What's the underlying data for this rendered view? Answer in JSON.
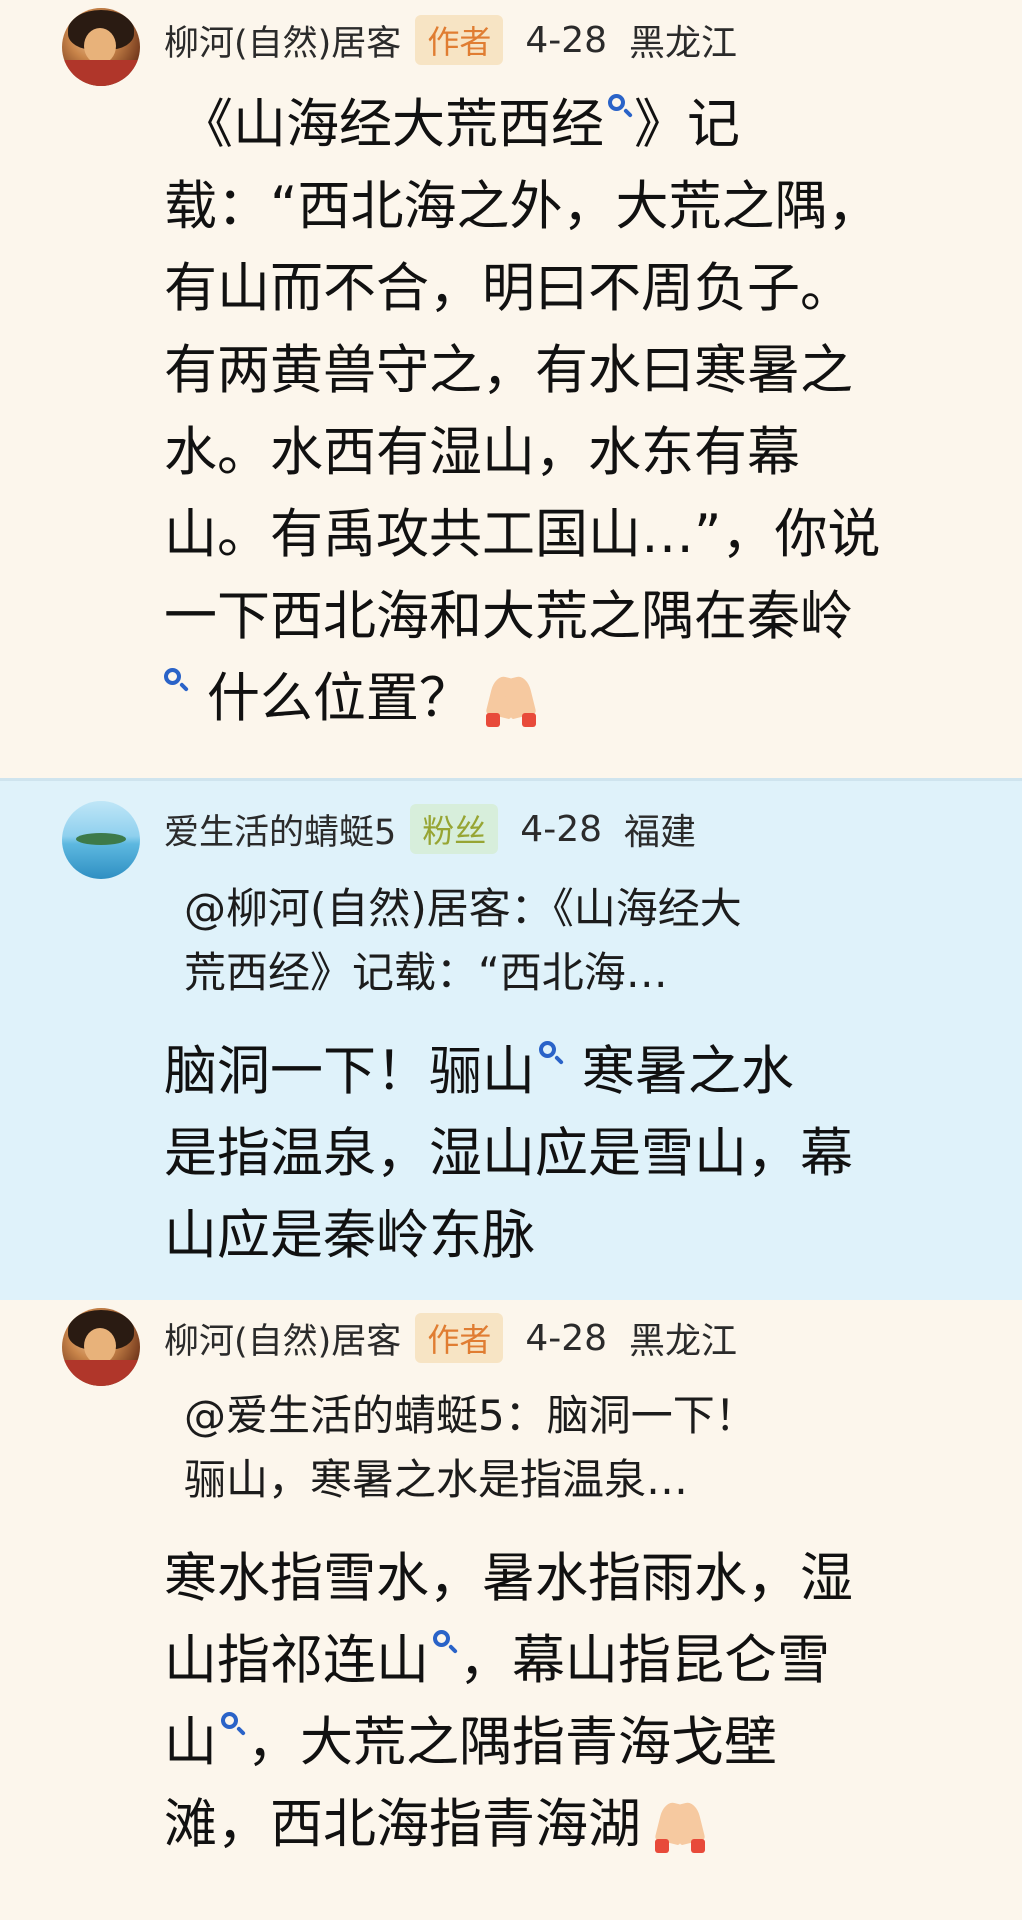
{
  "comments": [
    {
      "username": "柳河(自然)居客",
      "badge": "作者",
      "date": "4-28",
      "location": "黑龙江",
      "body_lines": [
        "《山海经大荒西经",
        "》记",
        "载：“西北海之外，大荒之隅，",
        "有山而不合，明曰不周负子。",
        "有两黄兽守之，有水曰寒暑之",
        "水。水西有湿山，水东有幕",
        "山。有禹攻共工国山…”，你说",
        "一下西北海和大荒之隅在秦岭",
        "什么位置？"
      ]
    },
    {
      "username": "爱生活的蜻蜓5",
      "badge": "粉丝",
      "date": "4-28",
      "location": "福建",
      "quote_lines": [
        "@柳河(自然)居客：《山海经大",
        "荒西经》记载：“西北海…"
      ],
      "body_lines": [
        "脑洞一下！骊山",
        "寒暑之水",
        "是指温泉，湿山应是雪山，幕",
        "山应是秦岭东脉"
      ]
    },
    {
      "username": "柳河(自然)居客",
      "badge": "作者",
      "date": "4-28",
      "location": "黑龙江",
      "quote_lines": [
        "@爱生活的蜻蜓5：脑洞一下！",
        "骊山，寒暑之水是指温泉…"
      ],
      "body_lines": [
        "寒水指雪水，暑水指雨水，湿",
        "山指祁连山",
        "，幕山指昆仑雪",
        "山",
        "，大荒之隅指青海戈壁",
        "滩，西北海指青海湖"
      ]
    }
  ],
  "icons": {
    "link": "search-link-icon",
    "reaction": "praying-hands-emoji"
  },
  "colors": {
    "page_bg": "#fcf6ec",
    "highlight_bg": "#dff2fa",
    "author_badge_bg": "#f7e4c4",
    "author_badge_text": "#e07d32",
    "fan_badge_bg": "#d7eedb",
    "fan_badge_text": "#97a533",
    "link_icon": "#2a63c8"
  }
}
